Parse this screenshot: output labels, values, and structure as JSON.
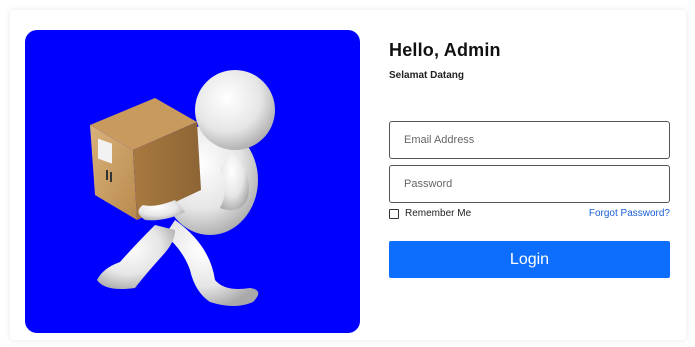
{
  "hero": {
    "background_color": "#0000ff",
    "illustration": "person-carrying-box-illustration"
  },
  "form": {
    "title": "Hello, Admin",
    "subtitle": "Selamat Datang",
    "email_placeholder": "Email Address",
    "email_value": "",
    "password_placeholder": "Password",
    "password_value": "",
    "remember_label": "Remember Me",
    "remember_checked": false,
    "forgot_label": "Forgot Password?",
    "login_label": "Login"
  },
  "colors": {
    "accent": "#0d6efd",
    "link": "#1a5fd6"
  }
}
